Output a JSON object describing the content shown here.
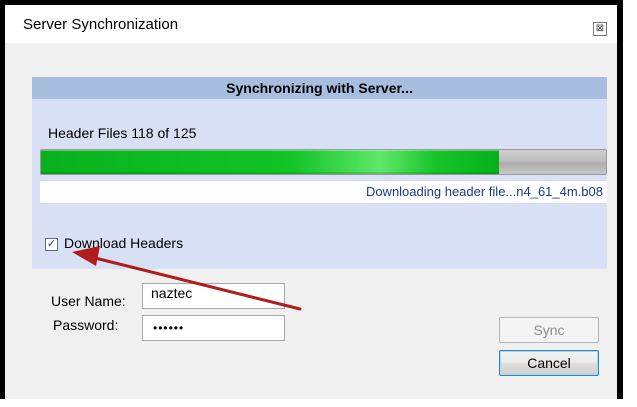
{
  "window": {
    "title": "Server Synchronization",
    "close_icon": "close-icon",
    "close_glyph": "⊠"
  },
  "sync_panel": {
    "header": "Synchronizing with Server...",
    "files_label": "Header Files 118 of 125",
    "progress": 0.81,
    "status": "Downloading header file...n4_61_4m.b08",
    "progress_color": "#12c428"
  },
  "options": {
    "download_headers_label": "Download Headers",
    "download_headers_checked": true,
    "check_glyph": "✓"
  },
  "login": {
    "user_label": "User Name:",
    "user_value": "naztec",
    "password_label": "Password:",
    "password_value": "••••••"
  },
  "buttons": {
    "sync_label": "Sync",
    "sync_enabled": false,
    "cancel_label": "Cancel"
  },
  "annotation": {
    "arrow_color": "#b11d1d"
  }
}
